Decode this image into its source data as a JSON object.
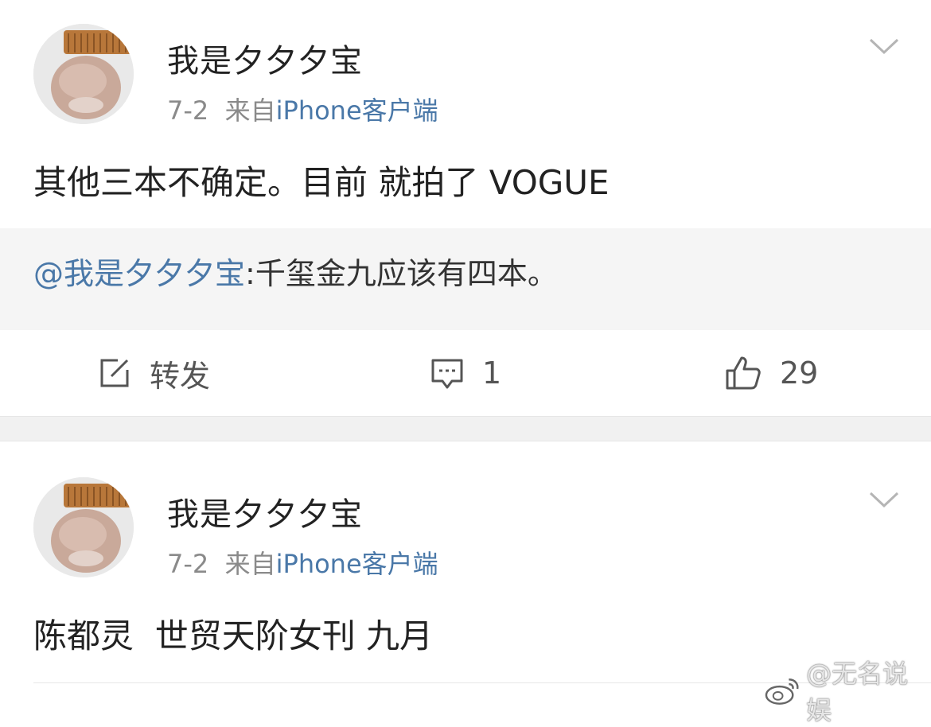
{
  "posts": [
    {
      "username": "我是夕夕夕宝",
      "date": "7-2",
      "from_label": "来自",
      "source": "iPhone客户端",
      "text": "其他三本不确定。目前 就拍了 VOGUE",
      "repost": {
        "mention": "@我是夕夕夕宝",
        "text": ":千玺金九应该有四本。"
      },
      "actions": {
        "repost_label": "转发",
        "comment_count": "1",
        "like_count": "29"
      }
    },
    {
      "username": "我是夕夕夕宝",
      "date": "7-2",
      "from_label": "来自",
      "source": "iPhone客户端",
      "text": "陈都灵  世贸天阶女刊 九月"
    }
  ],
  "watermark": "@无名说娱",
  "icons": {
    "avatar": "hamster-with-comb-avatar",
    "menu": "chevron-down-icon",
    "repost": "repost-icon",
    "comment": "comment-icon",
    "like": "thumbs-up-icon",
    "watermark": "weibo-logo-icon"
  },
  "colors": {
    "link": "#4a78a8",
    "meta": "#8a8a8a",
    "repost_bg": "#f5f5f5",
    "separator": "#f1f1f1"
  }
}
